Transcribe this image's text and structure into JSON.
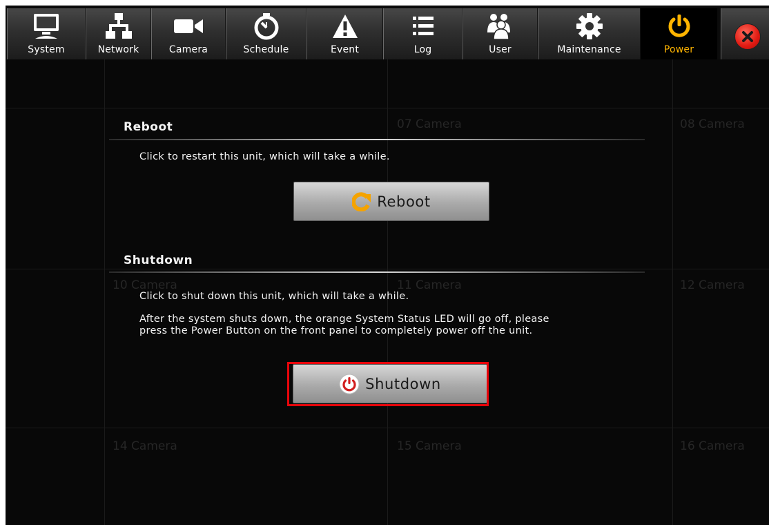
{
  "toolbar": {
    "tabs": [
      {
        "label": "System",
        "icon": "monitor-icon"
      },
      {
        "label": "Network",
        "icon": "network-icon"
      },
      {
        "label": "Camera",
        "icon": "camera-icon"
      },
      {
        "label": "Schedule",
        "icon": "stopwatch-icon"
      },
      {
        "label": "Event",
        "icon": "warning-icon"
      },
      {
        "label": "Log",
        "icon": "list-icon"
      },
      {
        "label": "User",
        "icon": "users-icon"
      },
      {
        "label": "Maintenance",
        "icon": "gear-icon"
      },
      {
        "label": "Power",
        "icon": "power-icon"
      }
    ],
    "active_tab": "Power",
    "close_icon": "close-icon"
  },
  "background": {
    "camera_labels": [
      "07 Camera",
      "08 Camera",
      "10 Camera",
      "11 Camera",
      "12 Camera",
      "14 Camera",
      "15 Camera",
      "16 Camera"
    ]
  },
  "reboot": {
    "title": "Reboot",
    "description": "Click to restart this unit, which will take a while.",
    "button_label": "Reboot",
    "button_icon": "reboot-icon"
  },
  "shutdown": {
    "title": "Shutdown",
    "description_1": "Click to shut down this unit, which will take a while.",
    "description_2_line1": "After the system shuts down, the orange System Status LED will go off, please",
    "description_2_line2": "press the Power Button on the front panel to completely power off the unit.",
    "button_label": "Shutdown",
    "button_icon": "power-icon"
  },
  "colors": {
    "accent": "#ffb400",
    "highlight": "#e8050b",
    "background": "#080808"
  }
}
